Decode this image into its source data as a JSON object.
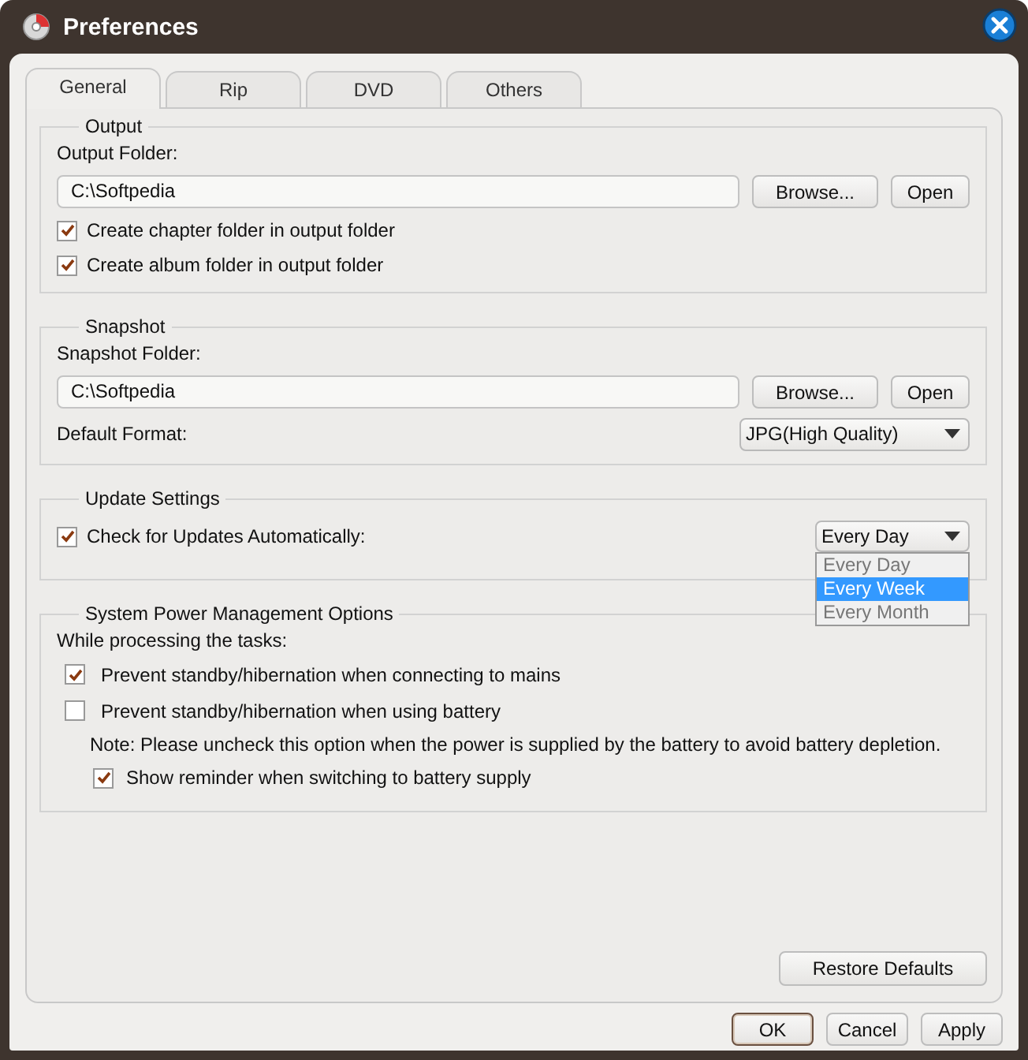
{
  "window": {
    "title": "Preferences"
  },
  "tabs": [
    {
      "label": "General",
      "selected": true
    },
    {
      "label": "Rip",
      "selected": false
    },
    {
      "label": "DVD",
      "selected": false
    },
    {
      "label": "Others",
      "selected": false
    }
  ],
  "output": {
    "title": "Output",
    "folder_label": "Output Folder:",
    "folder": "C:\\Softpedia",
    "browse": "Browse...",
    "open": "Open",
    "options": [
      {
        "label": "Create chapter folder in output folder",
        "checked": true
      },
      {
        "label": "Create album folder in output folder",
        "checked": true
      }
    ]
  },
  "snapshot": {
    "title": "Snapshot",
    "folder_label": "Snapshot Folder:",
    "folder": "C:\\Softpedia",
    "browse": "Browse...",
    "open": "Open",
    "format_label": "Default Format:",
    "format": "JPG(High Quality)"
  },
  "update": {
    "title": "Update Settings",
    "check": {
      "label": "Check for Updates Automatically:",
      "checked": true
    },
    "frequency": "Every Day",
    "dropdown": [
      {
        "label": "Every Day",
        "selected": false
      },
      {
        "label": "Every Week",
        "selected": true
      },
      {
        "label": "Every Month",
        "selected": false
      }
    ]
  },
  "power": {
    "title": "System Power Management Options",
    "intro": "While processing the tasks:",
    "options": [
      {
        "label": "Prevent standby/hibernation when connecting to mains",
        "checked": true
      },
      {
        "label": "Prevent standby/hibernation when using battery",
        "checked": false
      }
    ],
    "note": "Note: Please uncheck this option when the power is supplied by the battery to avoid battery depletion.",
    "reminder": {
      "label": "Show reminder when switching to battery supply",
      "checked": true
    }
  },
  "restore": "Restore Defaults",
  "buttons": [
    "OK",
    "Cancel",
    "Apply"
  ]
}
